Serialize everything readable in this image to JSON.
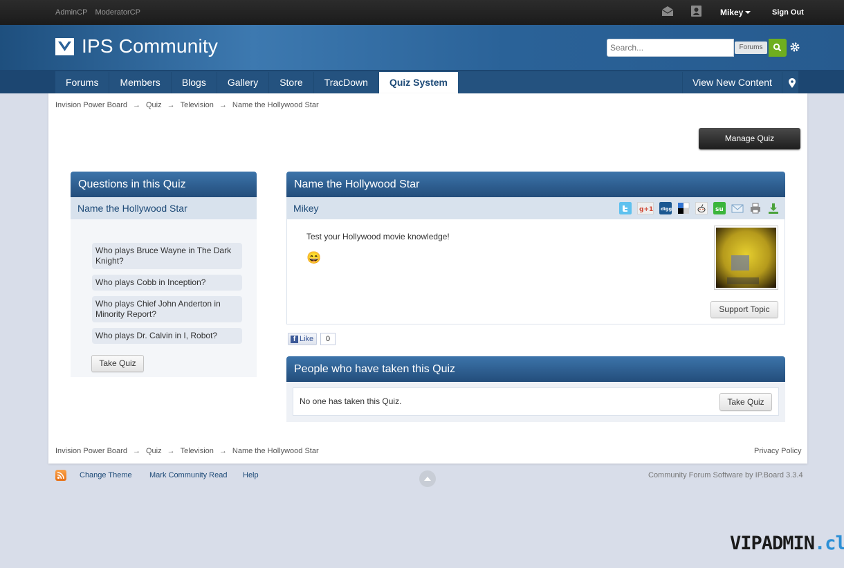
{
  "userbar": {
    "admin_cp": "AdminCP",
    "moderator_cp": "ModeratorCP",
    "username": "Mikey",
    "sign_out": "Sign Out"
  },
  "branding": {
    "logo_text": "IPS Community",
    "search_placeholder": "Search...",
    "search_scope": "Forums"
  },
  "nav": {
    "tabs": [
      "Forums",
      "Members",
      "Blogs",
      "Gallery",
      "Store",
      "TracDown",
      "Quiz System"
    ],
    "active_tab": "Quiz System",
    "view_new_content": "View New Content"
  },
  "breadcrumb": [
    "Invision Power Board",
    "Quiz",
    "Television",
    "Name the Hollywood Star"
  ],
  "breadcrumb_separator": "→",
  "manage_quiz": "Manage Quiz",
  "questions_block": {
    "title": "Questions in this Quiz",
    "quiz_name": "Name the Hollywood Star",
    "questions": [
      "Who plays Bruce Wayne in The Dark Knight?",
      "Who plays Cobb in Inception?",
      "Who plays Chief John Anderton in Minority Report?",
      "Who plays Dr. Calvin in I, Robot?"
    ],
    "take_quiz": "Take Quiz"
  },
  "quiz_block": {
    "title": "Name the Hollywood Star",
    "author": "Mikey",
    "description": "Test your Hollywood movie knowledge!",
    "emoticon": "😄",
    "support_topic": "Support Topic",
    "share_icons": [
      "twitter-icon",
      "google-plus-icon",
      "digg-icon",
      "delicious-icon",
      "reddit-icon",
      "stumbleupon-icon",
      "email-icon",
      "print-icon",
      "download-icon"
    ]
  },
  "like": {
    "label": "Like",
    "count": "0"
  },
  "taken_block": {
    "title": "People who have taken this Quiz",
    "empty_message": "No one has taken this Quiz.",
    "take_quiz": "Take Quiz"
  },
  "footer": {
    "privacy_policy": "Privacy Policy",
    "change_theme": "Change Theme",
    "mark_read": "Mark Community Read",
    "help": "Help",
    "powered_by": "Community Forum Software by IP.Board 3.3.4"
  },
  "watermark": {
    "main": "VIPADMIN",
    "suffix": ".club"
  },
  "colors": {
    "header_blue": "#2a6298",
    "nav_blue": "#1c4671",
    "search_green": "#6fae1f",
    "link_blue": "#1d4a77"
  }
}
